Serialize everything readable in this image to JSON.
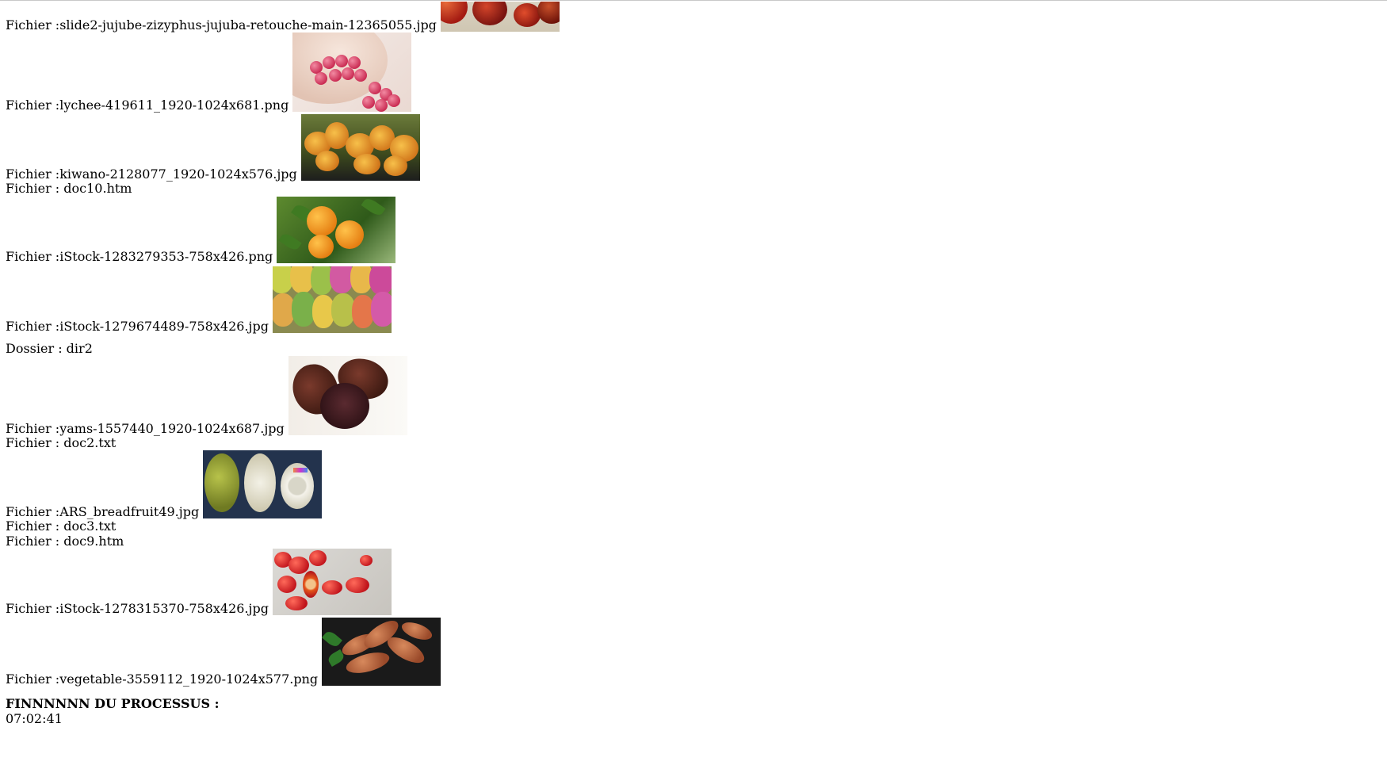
{
  "entries": [
    {
      "type": "image-file",
      "label": "Fichier :slide2-jujube-zizyphus-jujuba-retouche-main-12365055.jpg",
      "thumbnail": "jujube-photo"
    },
    {
      "type": "image-file",
      "label": "Fichier :lychee-419611_1920-1024x681.png",
      "thumbnail": "lychee-photo"
    },
    {
      "type": "image-file",
      "label": "Fichier :kiwano-2128077_1920-1024x576.jpg",
      "thumbnail": "kiwano-photo"
    },
    {
      "type": "file",
      "label": "Fichier : doc10.htm"
    },
    {
      "type": "image-file",
      "label": "Fichier :iStock-1283279353-758x426.png",
      "thumbnail": "orange-photo"
    },
    {
      "type": "image-file",
      "label": "Fichier :iStock-1279674489-758x426.jpg",
      "thumbnail": "prickly-pear-photo"
    },
    {
      "type": "folder",
      "label": "Dossier : dir2"
    },
    {
      "type": "image-file",
      "label": "Fichier :yams-1557440_1920-1024x687.jpg",
      "thumbnail": "yams-photo"
    },
    {
      "type": "file",
      "label": "Fichier : doc2.txt"
    },
    {
      "type": "image-file",
      "label": "Fichier :ARS_breadfruit49.jpg",
      "thumbnail": "breadfruit-photo"
    },
    {
      "type": "file",
      "label": "Fichier : doc3.txt"
    },
    {
      "type": "file",
      "label": "Fichier : doc9.htm"
    },
    {
      "type": "image-file",
      "label": "Fichier :iStock-1278315370-758x426.jpg",
      "thumbnail": "rosehip-photo"
    },
    {
      "type": "image-file",
      "label": "Fichier :vegetable-3559112_1920-1024x577.png",
      "thumbnail": "sweet-potato-photo"
    }
  ],
  "footer": {
    "end_label": "FINNNNNN DU PROCESSUS :",
    "time": "07:02:41"
  }
}
